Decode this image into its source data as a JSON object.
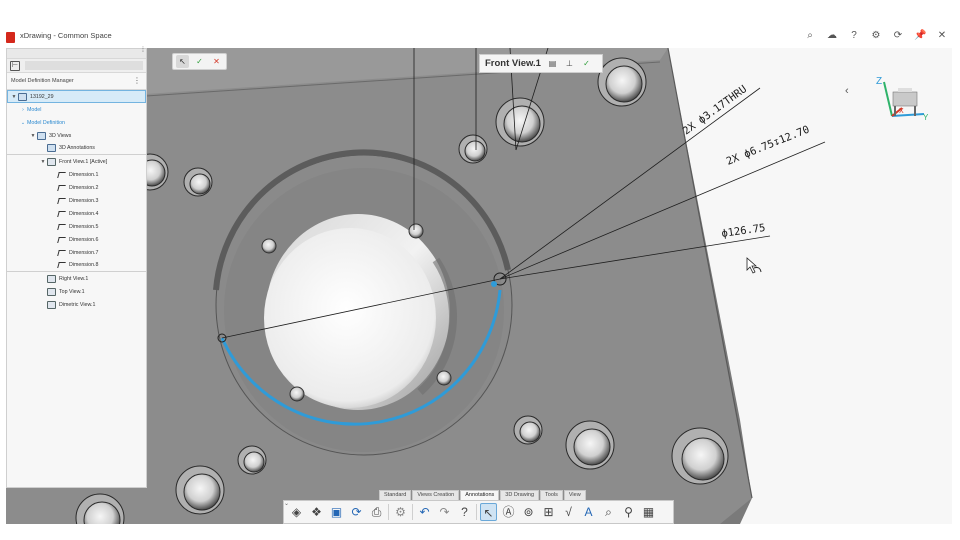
{
  "window": {
    "title": "xDrawing - Common Space"
  },
  "window_icons": [
    "search-icon",
    "cloud-icon",
    "help-icon",
    "settings-icon",
    "sync-icon",
    "pin-icon",
    "close-icon"
  ],
  "panel": {
    "title": "Model Definition Manager",
    "tree": [
      {
        "label": "13192_29",
        "indent": 0,
        "toggle": "▼",
        "type": "root"
      },
      {
        "label": "Model",
        "indent": 1,
        "toggle": "›",
        "type": "link"
      },
      {
        "label": "Model Definition",
        "indent": 1,
        "toggle": "⌄",
        "type": "link"
      },
      {
        "label": "3D Views",
        "indent": 2,
        "toggle": "▼",
        "type": "folder"
      },
      {
        "label": "3D Annotations",
        "indent": 3,
        "toggle": "",
        "type": "item",
        "sep": true
      },
      {
        "label": "Front View.1 [Active]",
        "indent": 3,
        "toggle": "▼",
        "type": "view"
      },
      {
        "label": "Dimension.1",
        "indent": 4,
        "toggle": "",
        "type": "dim"
      },
      {
        "label": "Dimension.2",
        "indent": 4,
        "toggle": "",
        "type": "dim"
      },
      {
        "label": "Dimension.3",
        "indent": 4,
        "toggle": "",
        "type": "dim"
      },
      {
        "label": "Dimension.4",
        "indent": 4,
        "toggle": "",
        "type": "dim"
      },
      {
        "label": "Dimension.5",
        "indent": 4,
        "toggle": "",
        "type": "dim"
      },
      {
        "label": "Dimension.6",
        "indent": 4,
        "toggle": "",
        "type": "dim"
      },
      {
        "label": "Dimension.7",
        "indent": 4,
        "toggle": "",
        "type": "dim"
      },
      {
        "label": "Dimension.8",
        "indent": 4,
        "toggle": "",
        "type": "dim",
        "sep": true
      },
      {
        "label": "Right View.1",
        "indent": 3,
        "toggle": "",
        "type": "view"
      },
      {
        "label": "Top View.1",
        "indent": 3,
        "toggle": "",
        "type": "view"
      },
      {
        "label": "Dimetric View.1",
        "indent": 3,
        "toggle": "",
        "type": "view"
      }
    ]
  },
  "view_bar": {
    "title": "Front View.1"
  },
  "annotations": {
    "a1": "2X  ϕ3.17THRU",
    "a2": "2X  ϕ6.75↧12.70",
    "a3": "ϕ126.75"
  },
  "triad": {
    "x": "X",
    "y": "Y",
    "z": "Z"
  },
  "command_tabs": [
    "Standard",
    "Views Creation",
    "Annotations",
    "3D Drawing",
    "Tools",
    "View"
  ],
  "active_command_tab": "Annotations",
  "colors": {
    "selection": "#2f9bd8",
    "part": "#8a8a8a",
    "accept": "#2e9e3a",
    "cancel": "#d43a2a"
  }
}
